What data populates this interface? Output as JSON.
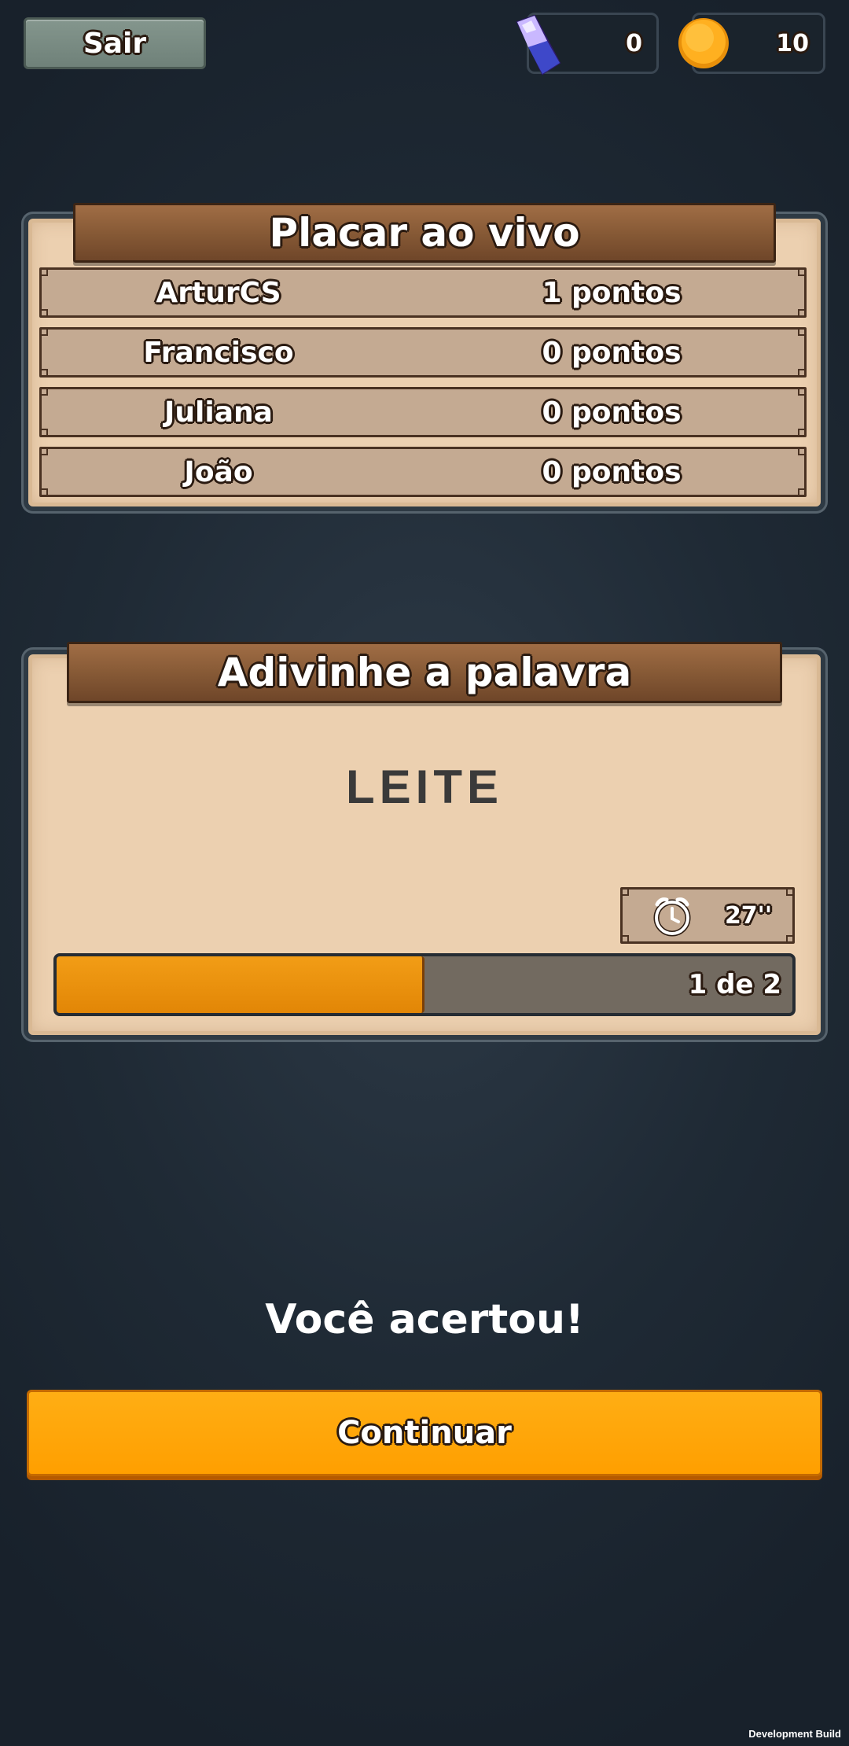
{
  "header": {
    "exit_label": "Sair",
    "gems": "0",
    "coins": "10"
  },
  "scoreboard": {
    "title": "Placar ao vivo",
    "rows": [
      {
        "name": "ArturCS",
        "points": "1 pontos"
      },
      {
        "name": "Francisco",
        "points": "0 pontos"
      },
      {
        "name": "Juliana",
        "points": "0 pontos"
      },
      {
        "name": "João",
        "points": "0 pontos"
      }
    ]
  },
  "guess": {
    "title": "Adivinhe a palavra",
    "word": "LEITE",
    "timer": "27''",
    "progress": {
      "label": "1 de 2",
      "fraction": 0.5
    }
  },
  "result": {
    "message": "Você acertou!",
    "continue_label": "Continuar"
  },
  "footer": {
    "build_label": "Development Build"
  },
  "colors": {
    "accent": "#ffa500",
    "panel": "#ecd0b0",
    "plank": "#875a36",
    "progress_fill": "#e68a06"
  }
}
